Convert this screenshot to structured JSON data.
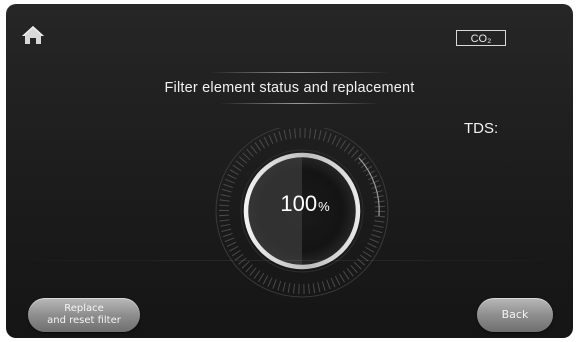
{
  "header": {
    "home_icon": "home-icon",
    "co2_badge": "CO₂"
  },
  "main": {
    "title": "Filter element status and replacement",
    "tds_label": "TDS:",
    "gauge": {
      "value": "100",
      "unit": "%",
      "level_percent": 100
    }
  },
  "footer": {
    "replace_label_line1": "Replace",
    "replace_label_line2": "and reset filter",
    "back_label": "Back"
  }
}
